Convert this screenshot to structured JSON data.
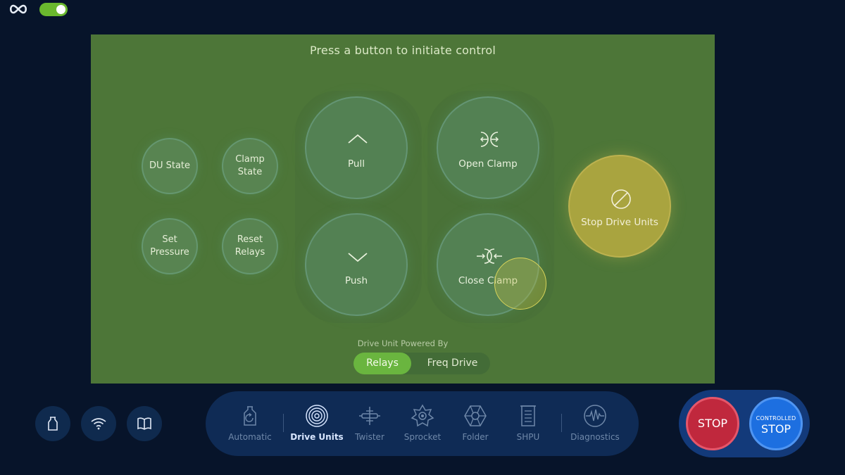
{
  "topbar": {
    "logo_icon": "infinity-icon",
    "toggle_on": true,
    "accent": "#6ab82e"
  },
  "panel": {
    "background": "#4d7638",
    "title": "Press a button to initiate control",
    "small_buttons": {
      "du_state": "DU State",
      "clamp_state": "Clamp\nState",
      "set_pressure": "Set\nPressure",
      "reset_relays": "Reset\nRelays"
    },
    "big_buttons": {
      "pull": {
        "label": "Pull",
        "icon": "chevron-up-icon"
      },
      "push": {
        "label": "Push",
        "icon": "chevron-down-icon"
      },
      "open_clamp": {
        "label": "Open Clamp",
        "icon": "open-clamp-icon"
      },
      "close_clamp": {
        "label": "Close Clamp",
        "icon": "close-clamp-icon"
      }
    },
    "stop_drive_units": {
      "label": "Stop Drive Units",
      "icon": "prohibited-icon",
      "color": "#a9a43f"
    },
    "powered_by": {
      "label": "Drive Unit Powered By",
      "options": [
        "Relays",
        "Freq Drive"
      ],
      "selected": "Relays"
    }
  },
  "bottom_left": {
    "icons": [
      "canister-icon",
      "wifi-icon",
      "book-icon"
    ]
  },
  "nav": {
    "items": [
      {
        "label": "Automatic",
        "icon": "automatic-icon",
        "active": false
      },
      {
        "label": "Drive Units",
        "icon": "drive-units-icon",
        "active": true
      },
      {
        "label": "Twister",
        "icon": "twister-icon",
        "active": false
      },
      {
        "label": "Sprocket",
        "icon": "sprocket-icon",
        "active": false
      },
      {
        "label": "Folder",
        "icon": "folder-icon",
        "active": false
      },
      {
        "label": "SHPU",
        "icon": "shpu-icon",
        "active": false
      },
      {
        "label": "Diagnostics",
        "icon": "diagnostics-icon",
        "active": false
      }
    ]
  },
  "stops": {
    "stop_label": "STOP",
    "controlled_small": "CONTROLLED",
    "controlled_big": "STOP",
    "stop_color": "#c0283d",
    "controlled_color": "#1d6fe0"
  }
}
